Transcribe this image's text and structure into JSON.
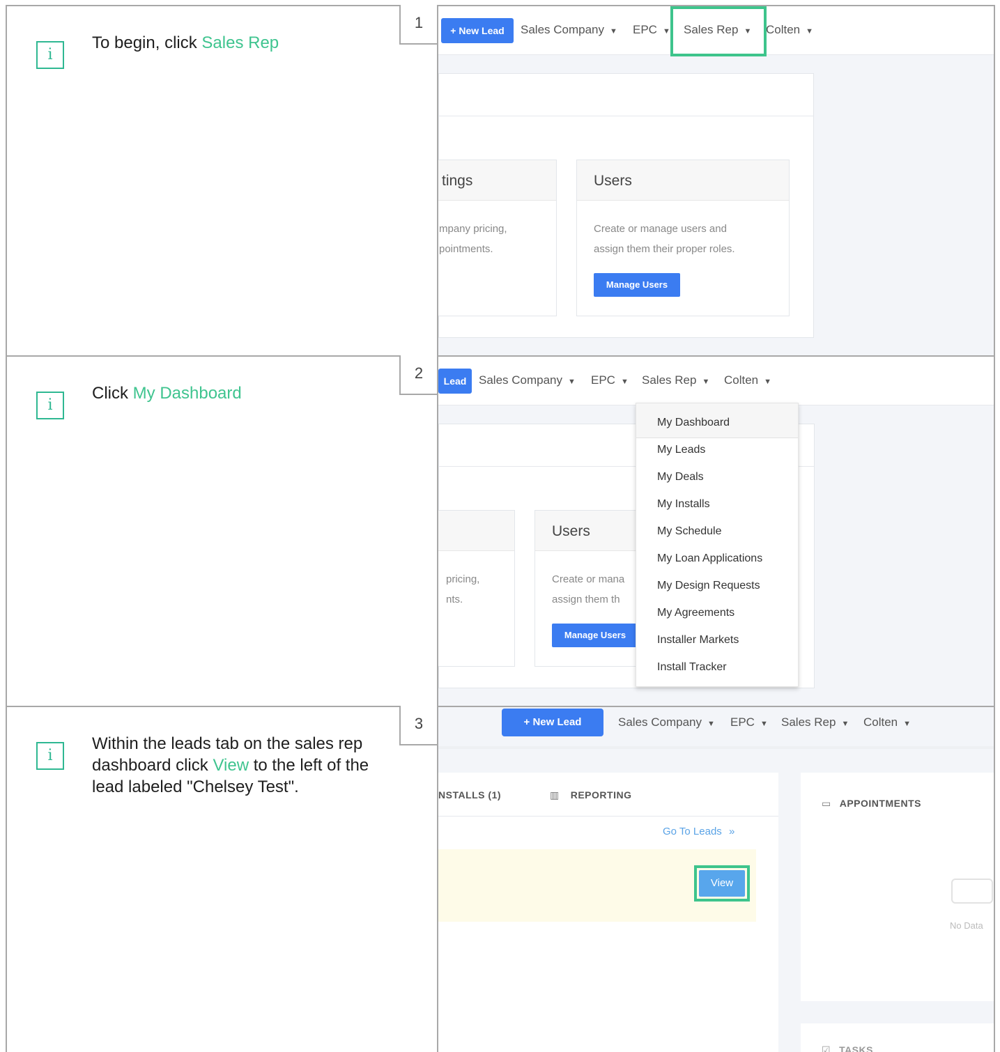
{
  "steps": [
    {
      "number": "1",
      "text_before": "To begin, click ",
      "highlight": "Sales Rep",
      "text_after": "",
      "nav": {
        "new_lead": "+ New Lead",
        "sales_company": "Sales Company",
        "epc": "EPC",
        "sales_rep": "Sales Rep",
        "user": "Colten"
      },
      "cards": {
        "settings_title": "tings",
        "settings_line1": "mpany pricing,",
        "settings_line2": "pointments.",
        "users_title": "Users",
        "users_line1": "Create or manage users and",
        "users_line2": "assign them their proper roles.",
        "users_button": "Manage Users"
      }
    },
    {
      "number": "2",
      "text_before": "Click ",
      "highlight": "My Dashboard",
      "text_after": "",
      "nav": {
        "new_lead": "Lead",
        "sales_company": "Sales Company",
        "epc": "EPC",
        "sales_rep": "Sales Rep",
        "user": "Colten"
      },
      "cards": {
        "settings_line1": "pricing,",
        "settings_line2": "nts.",
        "users_title": "Users",
        "users_line1": "Create or mana",
        "users_line2": "assign them th",
        "users_button": "Manage Users"
      },
      "dropdown": [
        "My Dashboard",
        "My Leads",
        "My Deals",
        "My Installs",
        "My Schedule",
        "My Loan Applications",
        "My Design Requests",
        "My Agreements",
        "Installer Markets",
        "Install Tracker"
      ]
    },
    {
      "number": "3",
      "text_before": "Within the leads tab on the sales rep dashboard click ",
      "highlight": "View",
      "text_after": " to the left of the lead labeled \"Chelsey Test\".",
      "nav": {
        "new_lead": "+ New Lead",
        "sales_company": "Sales Company",
        "epc": "EPC",
        "sales_rep": "Sales Rep",
        "user": "Colten"
      },
      "tabs": {
        "installs": "NSTALLS (1)",
        "reporting": "REPORTING"
      },
      "go_to_leads": "Go To Leads",
      "view_button": "View",
      "appointments": "APPOINTMENTS",
      "no_data": "No Data",
      "tasks": "TASKS"
    }
  ],
  "colors": {
    "highlight": "#3fc48f",
    "primary_button": "#3b7cf1",
    "border": "#a8a8a8"
  }
}
